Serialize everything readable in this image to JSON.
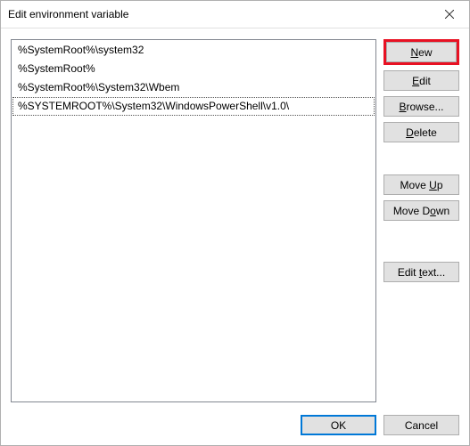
{
  "window": {
    "title": "Edit environment variable"
  },
  "list": {
    "items": [
      "%SystemRoot%\\system32",
      "%SystemRoot%",
      "%SystemRoot%\\System32\\Wbem",
      "%SYSTEMROOT%\\System32\\WindowsPowerShell\\v1.0\\"
    ],
    "selected_index": 3
  },
  "buttons": {
    "new": {
      "pre": "",
      "u": "N",
      "post": "ew"
    },
    "edit": {
      "pre": "",
      "u": "E",
      "post": "dit"
    },
    "browse": {
      "pre": "",
      "u": "B",
      "post": "rowse..."
    },
    "delete": {
      "pre": "",
      "u": "D",
      "post": "elete"
    },
    "moveup": {
      "pre": "Move ",
      "u": "U",
      "post": "p"
    },
    "movedown": {
      "pre": "Move D",
      "u": "o",
      "post": "wn"
    },
    "edittext": {
      "pre": "Edit ",
      "u": "t",
      "post": "ext..."
    },
    "ok": "OK",
    "cancel": "Cancel"
  },
  "highlight_button": "new"
}
